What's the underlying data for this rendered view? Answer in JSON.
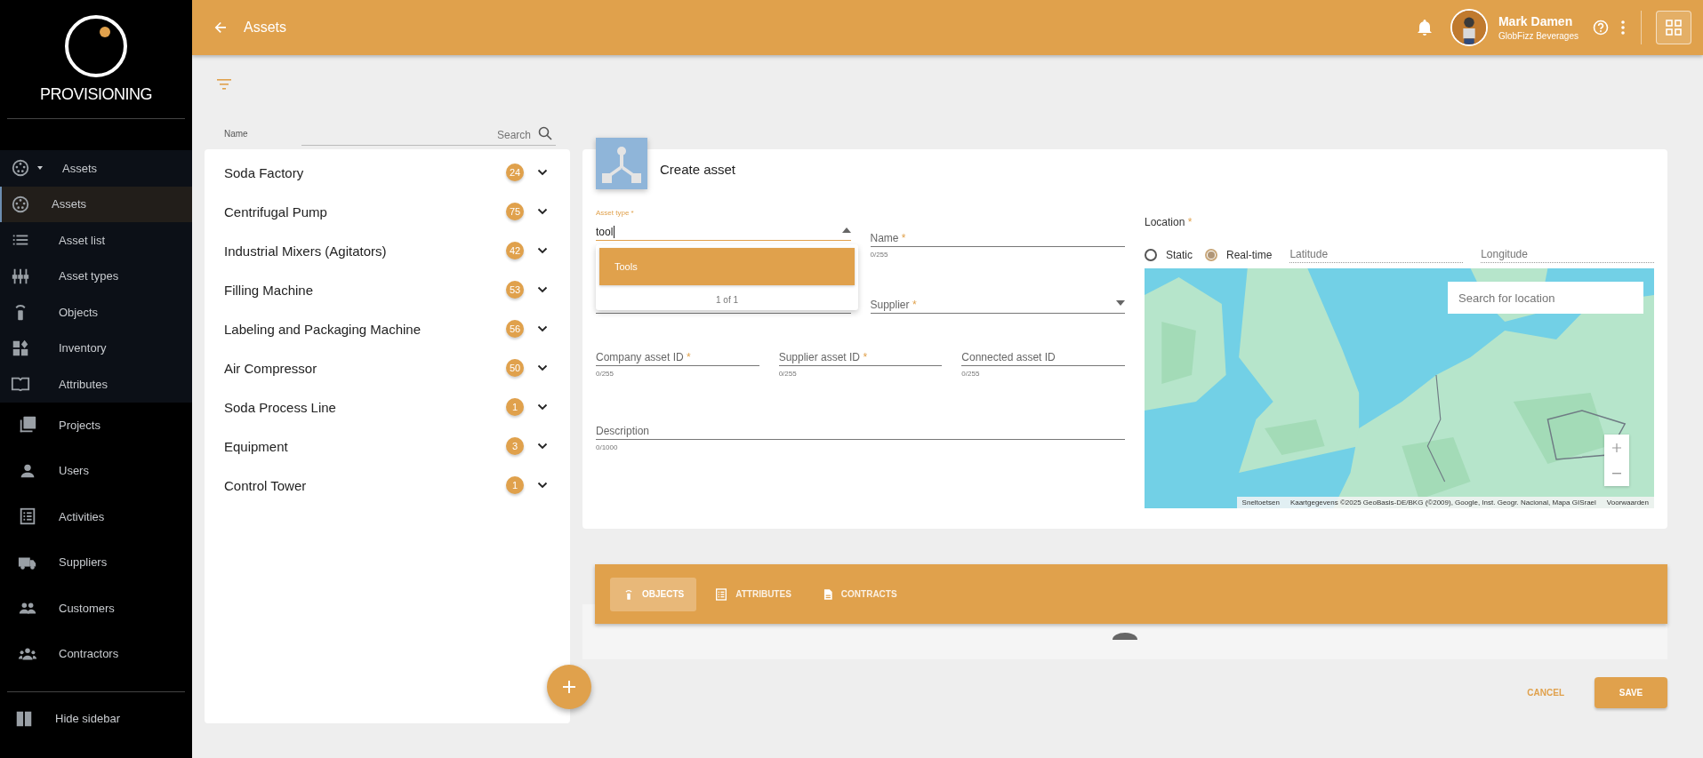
{
  "sidebar": {
    "logo": "PROVISIONING",
    "group": {
      "label": "Assets",
      "expanded": true,
      "children": [
        {
          "label": "Assets",
          "selected": true
        },
        {
          "label": "Asset list",
          "selected": false
        },
        {
          "label": "Asset types",
          "selected": false
        },
        {
          "label": "Objects",
          "selected": false
        },
        {
          "label": "Inventory",
          "selected": false
        },
        {
          "label": "Attributes",
          "selected": false
        }
      ]
    },
    "items": [
      {
        "label": "Projects",
        "selected": false
      },
      {
        "label": "Users",
        "selected": false
      },
      {
        "label": "Activities",
        "selected": false
      },
      {
        "label": "Suppliers",
        "selected": false
      },
      {
        "label": "Customers",
        "selected": false
      },
      {
        "label": "Contractors",
        "selected": false
      }
    ],
    "footer": "Hide sidebar"
  },
  "topbar": {
    "title": "Assets",
    "user": {
      "name": "Mark Damen",
      "company": "GlobFizz Beverages"
    }
  },
  "asset_list": {
    "column": "Name",
    "search": {
      "placeholder": "Search"
    },
    "items": [
      {
        "name": "Soda Factory",
        "count": "24",
        "expanded": false
      },
      {
        "name": "Centrifugal Pump",
        "count": "75",
        "expanded": false
      },
      {
        "name": "Industrial Mixers (Agitators)",
        "count": "42",
        "expanded": false
      },
      {
        "name": "Filling Machine",
        "count": "53",
        "expanded": false
      },
      {
        "name": "Labeling and Packaging Machine",
        "count": "56",
        "expanded": false
      },
      {
        "name": "Air Compressor",
        "count": "50",
        "expanded": false
      },
      {
        "name": "Soda Process Line",
        "count": "1",
        "expanded": false
      },
      {
        "name": "Equipment",
        "count": "3",
        "expanded": false
      },
      {
        "name": "Control Tower",
        "count": "1",
        "expanded": false
      }
    ]
  },
  "form": {
    "title": "Create asset",
    "asset_type": {
      "label": "Asset type",
      "required_mark": "*",
      "value": "tool",
      "focused": true,
      "dropdown": {
        "options": [
          {
            "label": "Tools",
            "selected": true
          }
        ],
        "counter": "1 of 1"
      }
    },
    "name": {
      "label": "Name",
      "required_mark": "*",
      "counter": "0/255"
    },
    "supplier": {
      "label": "Supplier",
      "required_mark": "*"
    },
    "ids": [
      {
        "label": "Company asset ID",
        "required_mark": "*",
        "counter": "0/255"
      },
      {
        "label": "Supplier asset ID",
        "required_mark": "*",
        "counter": "0/255"
      },
      {
        "label": "Connected asset ID",
        "counter": "0/255"
      }
    ],
    "description": {
      "label": "Description",
      "counter": "0/1000"
    },
    "location": {
      "label": "Location",
      "required_mark": "*",
      "modes": [
        {
          "label": "Static",
          "selected": false
        },
        {
          "label": "Real-time",
          "selected": true
        }
      ],
      "latitude": {
        "placeholder": "Latitude"
      },
      "longitude": {
        "placeholder": "Longitude"
      },
      "map": {
        "search": {
          "placeholder": "Search for location"
        },
        "attribution": [
          "Sneltoetsen",
          "Kaartgegevens ©2025 GeoBasis-DE/BKG (©2009), Google, Inst. Geogr. Nacional, Mapa GISrael",
          "Voorwaarden"
        ]
      }
    }
  },
  "tabs": [
    {
      "label": "OBJECTS",
      "selected": true
    },
    {
      "label": "ATTRIBUTES",
      "selected": false
    },
    {
      "label": "CONTRACTS",
      "selected": false
    }
  ],
  "actions": {
    "cancel": "CANCEL",
    "save": "SAVE"
  }
}
